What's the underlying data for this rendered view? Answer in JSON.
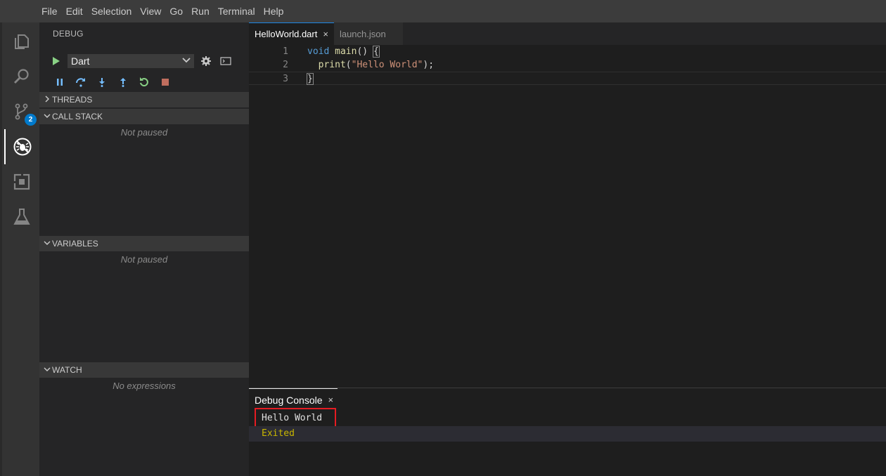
{
  "menubar": [
    "File",
    "Edit",
    "Selection",
    "View",
    "Go",
    "Run",
    "Terminal",
    "Help"
  ],
  "activitybar": {
    "icons": [
      "explorer-icon",
      "search-icon",
      "source-control-icon",
      "debug-icon",
      "extensions-icon",
      "testing-icon"
    ],
    "source_control_badge": "2"
  },
  "sidebar": {
    "title": "DEBUG",
    "config": {
      "selected": "Dart"
    },
    "sections": {
      "threads": "THREADS",
      "call_stack": "CALL STACK",
      "call_stack_empty": "Not paused",
      "variables": "VARIABLES",
      "variables_empty": "Not paused",
      "watch": "WATCH",
      "watch_empty": "No expressions"
    }
  },
  "editor": {
    "tabs": [
      {
        "label": "HelloWorld.dart",
        "active": true,
        "close": "×"
      },
      {
        "label": "launch.json",
        "active": false
      }
    ],
    "lines": [
      {
        "num": "1",
        "tokens": [
          {
            "t": "void",
            "c": "kw"
          },
          {
            "t": " ",
            "c": "pn"
          },
          {
            "t": "main",
            "c": "fn"
          },
          {
            "t": "() ",
            "c": "pn"
          },
          {
            "t": "{",
            "c": "pn brk"
          }
        ]
      },
      {
        "num": "2",
        "tokens": [
          {
            "t": "  ",
            "c": "pn"
          },
          {
            "t": "print",
            "c": "fn"
          },
          {
            "t": "(",
            "c": "pn"
          },
          {
            "t": "\"Hello World\"",
            "c": "str"
          },
          {
            "t": ");",
            "c": "pn"
          }
        ]
      },
      {
        "num": "3",
        "tokens": [
          {
            "t": "}",
            "c": "pn brk"
          }
        ]
      }
    ]
  },
  "panel": {
    "tab_label": "Debug Console",
    "close": "×",
    "output": [
      "Hello World",
      "Exited"
    ]
  },
  "colors": {
    "accent": "#007acc",
    "highlight_box": "#e51c23",
    "exited_text": "#c8b600",
    "play_green": "#89d185",
    "debug_blue": "#75beff",
    "stop_red": "#f48771"
  }
}
